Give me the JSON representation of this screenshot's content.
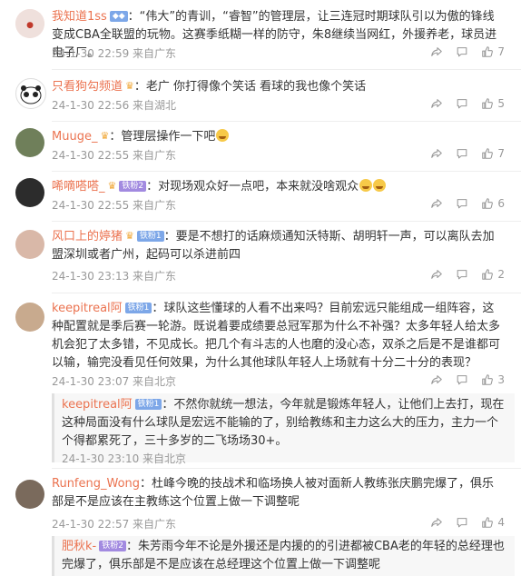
{
  "icons": {
    "share": "share-icon",
    "comment": "comment-icon",
    "like": "like-icon"
  },
  "comments": [
    {
      "name": "我知道1ss",
      "badge": "",
      "badge_color": "",
      "text": "：“伟大”的青训，“睿智”的管理层，让三连冠时期球队引以为傲的锋线变成CBA全联盟的玩物。这赛季纸糊一样的防守，朱8继续当网红，外援养老，球员进电子厂。",
      "time": "24-1-30 22:59 来自广东",
      "likes": "7"
    },
    {
      "name": "只看狗勾频道",
      "text": "：老广 你打得像个笑话 看球的我也像个笑话",
      "time": "24-1-30 22:56 来自湖北",
      "likes": "5"
    },
    {
      "name": "Muuge_",
      "text": "：管理层操作一下吧",
      "time": "24-1-30 22:55 来自广东",
      "likes": "7"
    },
    {
      "name": "唏嘀嗒嗒_",
      "badge": "铁粉2",
      "text": "：对现场观众好一点吧，本来就没啥观众",
      "time": "24-1-30 22:55 来自广东",
      "likes": "6"
    },
    {
      "name": "风口上的婷猪",
      "badge": "铁粉1",
      "text": "：要是不想打的话麻烦通知沃特斯、胡明轩一声，可以离队去加盟深圳或者广州，起码可以杀进前四",
      "time": "24-1-30 23:13 来自广东",
      "likes": "2"
    },
    {
      "name": "keepitreal阿",
      "badge": "铁粉1",
      "text": "：球队这些懂球的人看不出来吗？目前宏远只能组成一组阵容，这种配置就是季后赛一轮游。既说着要成绩要总冠军那为什么不补强？太多年轻人给太多机会犯了太多错，不见成长。把几个有斗志的人也磨的没心态，双杀之后是不是谁都可以输，输完没看见任何效果，为什么其他球队年轻人上场就有十分二十分的表现？",
      "time": "24-1-30 23:07 来自北京",
      "likes": "3"
    },
    {
      "name": "keepitreal阿",
      "badge": "铁粉1",
      "text": "：不然你就统一想法，今年就是锻炼年轻人，让他们上去打，现在这种局面没有什么球队是宏远不能输的了，别给教练和主力这么大的压力，主力一个个得都累死了，三十多岁的二飞场场30+。",
      "time": "24-1-30 23:10 来自北京"
    },
    {
      "name": "Runfeng_Wong",
      "text": "：杜峰今晚的技战术和临场换人被对面新人教练张庆鹏完爆了，俱乐部是不是应该在主教练这个位置上做一下调整呢",
      "time": "24-1-30 22:57 来自广东",
      "likes": "4"
    },
    {
      "name": "肥秋k-",
      "badge": "铁粉2",
      "text": "：朱芳雨今年不论是外援还是内援的的引进都被CBA老的年轻的总经理也完爆了，俱乐部是不是应该在总经理这个位置上做一下调整呢"
    }
  ]
}
